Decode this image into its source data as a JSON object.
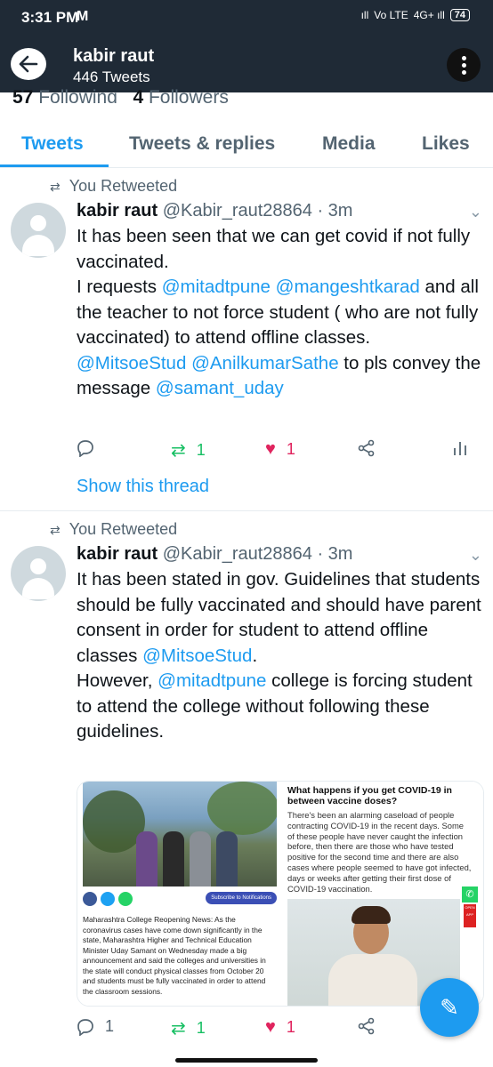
{
  "status": {
    "time": "3:31 PM",
    "app_glyph": "M",
    "signal": "ıll",
    "volte": "Vo LTE",
    "net": "4G+ ıll",
    "battery": "74"
  },
  "header": {
    "name": "kabir raut",
    "tweets_count": "446 Tweets",
    "following_count": "57",
    "following_label": "Following",
    "followers_count": "4",
    "followers_label": "Followers"
  },
  "tabs": [
    {
      "label": "Tweets"
    },
    {
      "label": "Tweets & replies"
    },
    {
      "label": "Media"
    },
    {
      "label": "Likes"
    }
  ],
  "tweets": [
    {
      "retweet_label": "You Retweeted",
      "name": "kabir raut",
      "handle_time": "@Kabir_raut28864 · 3m",
      "t1": "It has been seen that we can get covid if not fully vaccinated.",
      "t2a": "I requests ",
      "m1": "@mitadtpune",
      "m2": "@mangeshtkarad",
      "t2b": " and all the teacher to not force student ( who are not fully vaccinated) to attend offline classes.",
      "m3": "@MitsoeStud",
      "m4": "@AnilkumarSathe",
      "t3": " to pls convey the message ",
      "m5": "@samant_uday",
      "reply_count": "",
      "retweet_count": "1",
      "like_count": "1",
      "show_thread": "Show this thread"
    },
    {
      "retweet_label": "You Retweeted",
      "name": "kabir raut",
      "handle_time": "@Kabir_raut28864 · 3m",
      "t1": "It has been stated in gov. Guidelines that students should be fully vaccinated and should have parent consent in order for student to attend offline classes ",
      "m1": "@MitsoeStud",
      "t1b": ".",
      "t2a": "However, ",
      "m2": "@mitadtpune",
      "t2b": " college is forcing student to attend the college without following these guidelines.",
      "reply_count": "1",
      "retweet_count": "1",
      "like_count": "1"
    }
  ],
  "media": {
    "left_news": "Maharashtra College Reopening News: As the coronavirus cases have come down significantly in the state, Maharashtra Higher and Technical Education Minister Uday Samant on Wednesday made a big announcement and said the colleges and universities in the state will conduct physical classes from October 20 and students must be fully vaccinated in order to attend the classroom sessions.",
    "left_news_lead": "Maharashtra College Reopening News:",
    "subscribe": "Subscribe to Notifications",
    "right_title": "What happens if you get COVID-19 in between vaccine doses?",
    "right_body": "There's been an alarming caseload of people contracting COVID-19 in the recent days. Some of these people have never caught the infection before, then there are those who have tested positive for the second time and there are also cases where people seemed to have got infected, days or weeks after getting their first dose of COVID-19 vaccination.",
    "open_app": "OPEN APP"
  },
  "colors": {
    "brand": "#1d9bf0",
    "header_bg": "#1f2a36",
    "retweet_green": "#17bf63",
    "like_red": "#e0245e"
  }
}
